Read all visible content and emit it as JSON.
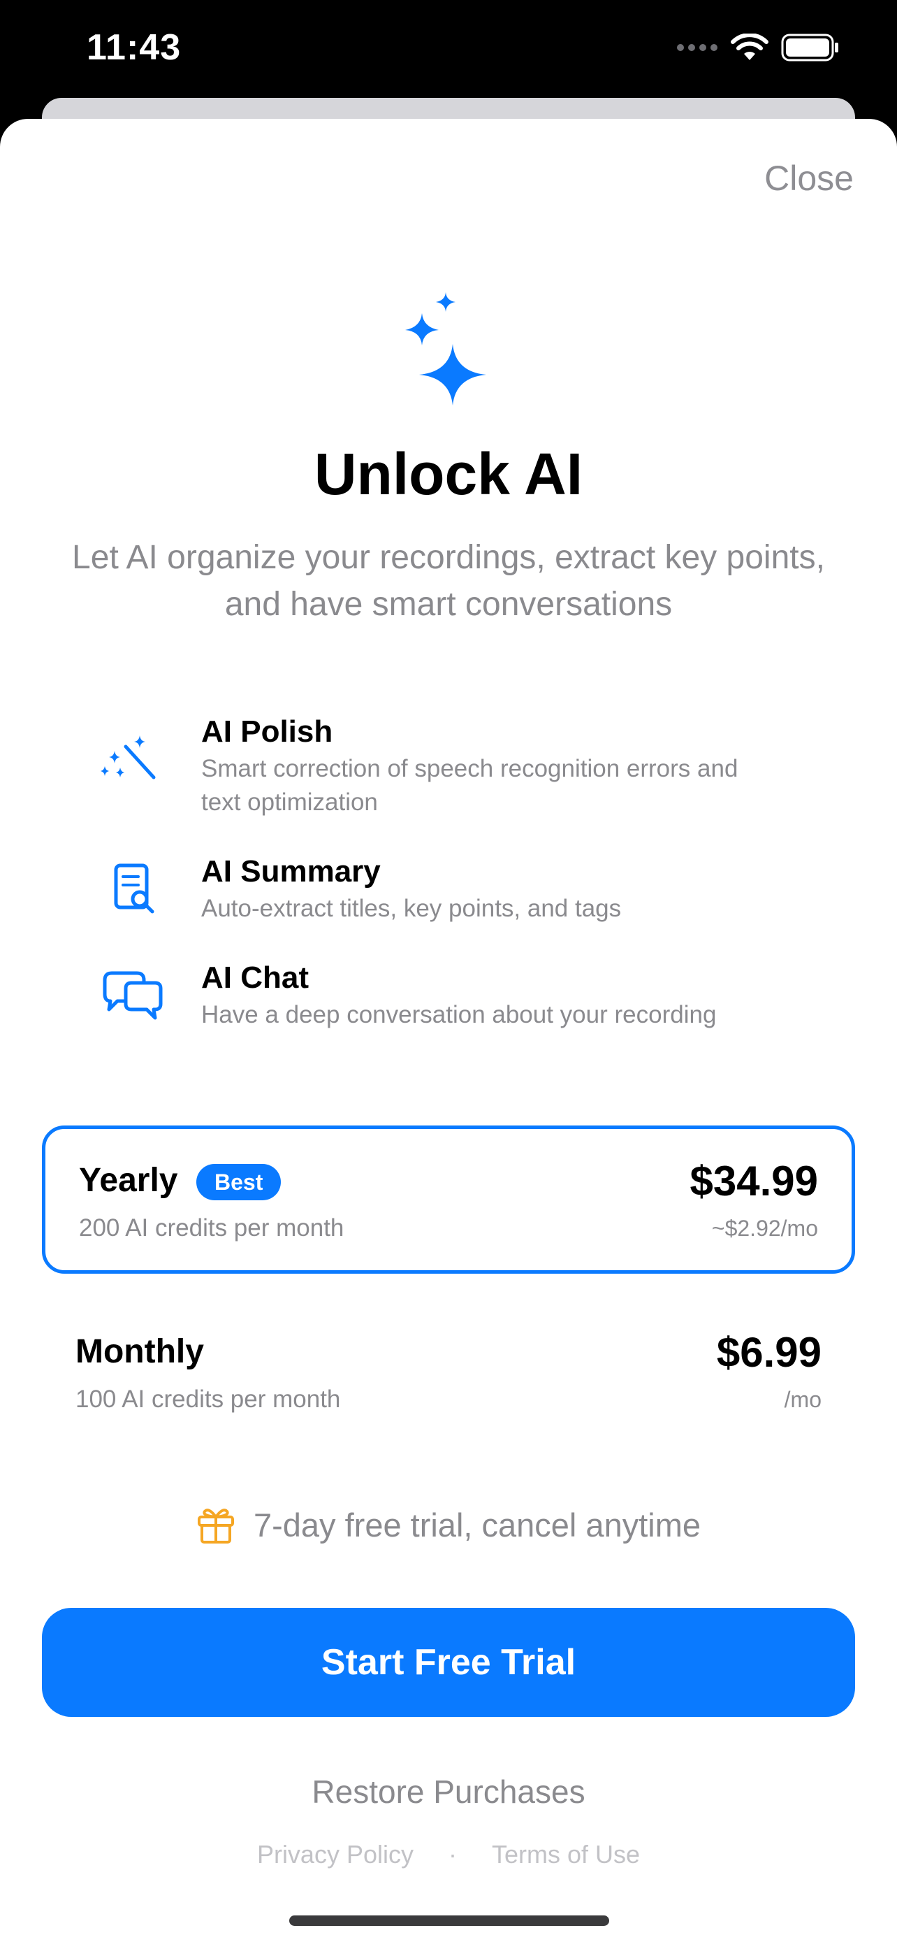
{
  "status_bar": {
    "time": "11:43"
  },
  "header": {
    "close_label": "Close"
  },
  "hero": {
    "icon": "sparkles-icon",
    "title": "Unlock AI",
    "subtitle_line1": "Let AI organize your recordings, extract key points,",
    "subtitle_line2": "and have smart conversations"
  },
  "features": [
    {
      "icon": "magic-wand-icon",
      "title": "AI Polish",
      "desc_line1": "Smart correction of speech recognition errors and",
      "desc_line2": "text optimization"
    },
    {
      "icon": "document-search-icon",
      "title": "AI Summary",
      "desc_line1": "Auto-extract titles, key points, and tags",
      "desc_line2": ""
    },
    {
      "icon": "chat-bubbles-icon",
      "title": "AI Chat",
      "desc_line1": "Have a deep conversation about your recording",
      "desc_line2": ""
    }
  ],
  "plans": [
    {
      "name": "Yearly",
      "badge": "Best",
      "desc": "200 AI credits per month",
      "price": "$34.99",
      "per": "~$2.92/mo",
      "selected": true
    },
    {
      "name": "Monthly",
      "badge": "",
      "desc": "100 AI credits per month",
      "price": "$6.99",
      "per": "/mo",
      "selected": false
    }
  ],
  "trial": {
    "icon": "gift-icon",
    "text": "7-day free trial, cancel anytime"
  },
  "cta_label": "Start Free Trial",
  "restore_label": "Restore Purchases",
  "footer": {
    "privacy_label": "Privacy Policy",
    "separator": "·",
    "terms_label": "Terms of Use"
  },
  "colors": {
    "accent": "#0a7aff",
    "gift": "#f5a623",
    "secondary_text": "#8a8a8e"
  }
}
